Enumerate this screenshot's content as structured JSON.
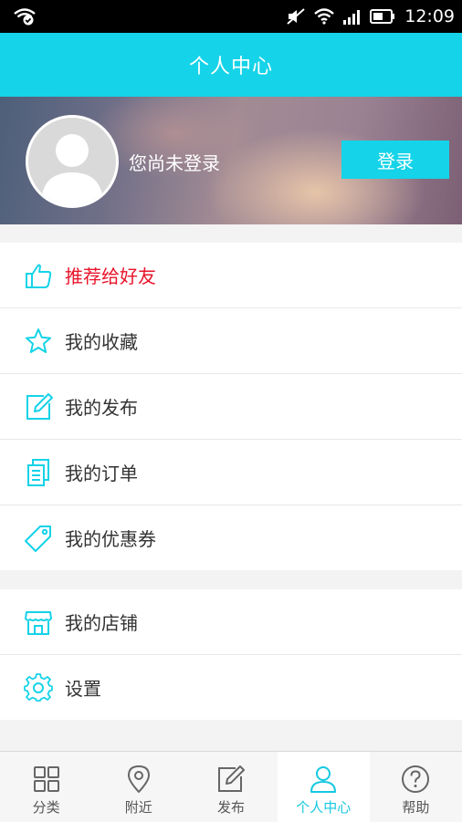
{
  "status_bar": {
    "time": "12:09"
  },
  "header": {
    "title": "个人中心"
  },
  "profile": {
    "login_hint": "您尚未登录",
    "login_button": "登录"
  },
  "menu_group_1": [
    {
      "label": "推荐给好友",
      "icon": "thumbs-up-icon"
    },
    {
      "label": "我的收藏",
      "icon": "star-icon"
    },
    {
      "label": "我的发布",
      "icon": "edit-icon"
    },
    {
      "label": "我的订单",
      "icon": "order-icon"
    },
    {
      "label": "我的优惠券",
      "icon": "coupon-tag-icon"
    }
  ],
  "menu_group_2": [
    {
      "label": "我的店铺",
      "icon": "shop-icon"
    },
    {
      "label": "设置",
      "icon": "gear-icon"
    }
  ],
  "tab_bar": [
    {
      "label": "分类",
      "icon": "grid-icon"
    },
    {
      "label": "附近",
      "icon": "location-pin-icon"
    },
    {
      "label": "发布",
      "icon": "edit-icon"
    },
    {
      "label": "个人中心",
      "icon": "user-icon",
      "active": true
    },
    {
      "label": "帮助",
      "icon": "help-icon"
    }
  ],
  "colors": {
    "accent": "#15d3e8",
    "highlight_text": "#e8142b"
  }
}
